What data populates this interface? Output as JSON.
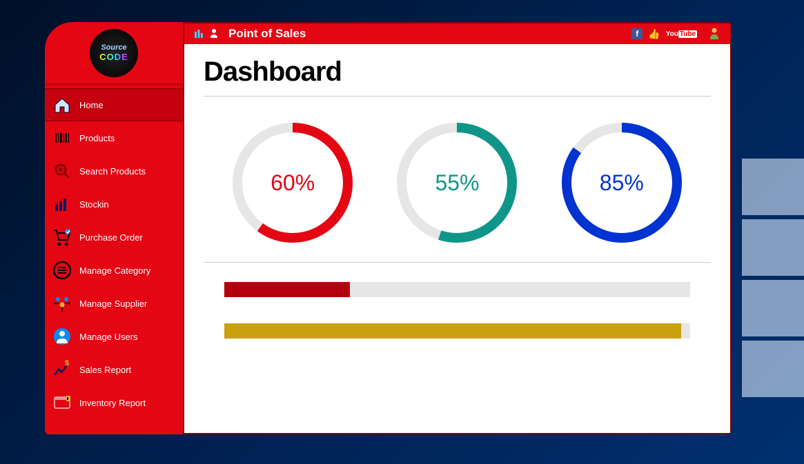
{
  "header": {
    "app_title": "Point of Sales"
  },
  "logo": {
    "line1": "Source",
    "line2": "CODE"
  },
  "sidebar": {
    "items": [
      {
        "label": "Home",
        "icon": "home-icon",
        "active": true
      },
      {
        "label": "Products",
        "icon": "barcode-icon",
        "active": false
      },
      {
        "label": "Search Products",
        "icon": "search-icon",
        "active": false
      },
      {
        "label": "Stockin",
        "icon": "chart-icon",
        "active": false
      },
      {
        "label": "Purchase Order",
        "icon": "cart-icon",
        "active": false
      },
      {
        "label": "Manage Category",
        "icon": "list-icon",
        "active": false
      },
      {
        "label": "Manage Supplier",
        "icon": "people-icon",
        "active": false
      },
      {
        "label": "Manage Users",
        "icon": "user-icon",
        "active": false
      },
      {
        "label": "Sales Report",
        "icon": "sales-icon",
        "active": false
      },
      {
        "label": "Inventory Report",
        "icon": "inventory-icon",
        "active": false
      }
    ]
  },
  "page": {
    "title": "Dashboard"
  },
  "chart_data": {
    "gauges": [
      {
        "value": 60,
        "label": "60%",
        "color": "#e40613"
      },
      {
        "value": 55,
        "label": "55%",
        "color": "#0f9688"
      },
      {
        "value": 85,
        "label": "85%",
        "color": "#0033d0"
      }
    ],
    "bars": [
      {
        "value": 27,
        "color": "#b4000e"
      },
      {
        "value": 98,
        "color": "#c9a10d"
      }
    ]
  },
  "topbar_icons": {
    "facebook": "f",
    "like": "👍",
    "youtube": "YouTube",
    "user": "👤"
  }
}
